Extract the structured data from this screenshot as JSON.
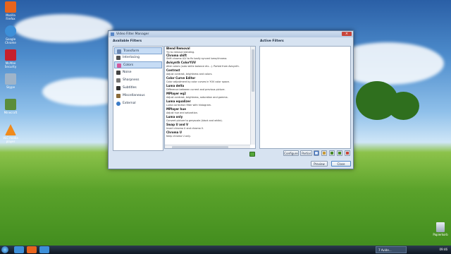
{
  "desktop": {
    "icons": [
      {
        "label": "Mozilla Firefox",
        "icon": "firefox-icon",
        "color": "#e8641d"
      },
      {
        "label": "Google Chrome",
        "icon": "chrome-icon",
        "color": "#3d8fd8"
      },
      {
        "label": "McAfee Security",
        "icon": "mcafee-icon",
        "color": "#c5202d"
      },
      {
        "label": "Skype",
        "icon": "skype-icon",
        "color": "#9fb4c9"
      },
      {
        "label": "Minecraft",
        "icon": "minecraft-icon",
        "color": "#5b8d3a"
      },
      {
        "label": "VLC media player",
        "icon": "vlc-icon",
        "color": "#f08a1c"
      }
    ],
    "recycle_bin_label": "Papierkorb"
  },
  "window": {
    "title": "Video Filter Manager",
    "available_heading": "Available Filters",
    "active_heading": "Active Filters",
    "categories": [
      {
        "label": "Transform",
        "icon": "transform-icon",
        "color": "#6b86b0"
      },
      {
        "label": "Interlacing",
        "icon": "interlacing-icon",
        "color": "#555555"
      },
      {
        "label": "Colors",
        "icon": "colors-icon",
        "color": "#d35a9c"
      },
      {
        "label": "Noise",
        "icon": "noise-icon",
        "color": "#444444"
      },
      {
        "label": "Sharpness",
        "icon": "sharpness-icon",
        "color": "#777777"
      },
      {
        "label": "Subtitles",
        "icon": "subtitles-icon",
        "color": "#333333"
      },
      {
        "label": "Miscellaneous",
        "icon": "misc-icon",
        "color": "#8a6b3a"
      },
      {
        "label": "External",
        "icon": "external-icon",
        "color": "#3b7bc6"
      }
    ],
    "filters": [
      {
        "name": "Blend Removal",
        "desc": "Try to remove blending."
      },
      {
        "name": "Chroma shift",
        "desc": "Shift chroma U/V to fix badly synced luma/chroma."
      },
      {
        "name": "Avisynth ColorYUV",
        "desc": "Alter colors (auto white balance etc...). Ported from Avisynth."
      },
      {
        "name": "Contrast",
        "desc": "Adjust contrast, brightness and colors."
      },
      {
        "name": "Color Curve Editor",
        "desc": "Color adjustment by color curves in YUV color space."
      },
      {
        "name": "Luma delta",
        "desc": "Difference between current and previous picture."
      },
      {
        "name": "MPlayer eq2",
        "desc": "Adjust contrast, brightness, saturation and gamma."
      },
      {
        "name": "Luma equalizer",
        "desc": "Luma correction filter with histogram."
      },
      {
        "name": "MPlayer hue",
        "desc": "Adjust hue and saturation."
      },
      {
        "name": "Luma only",
        "desc": "Convert picture to greyscale (black and white)."
      },
      {
        "name": "Swap U and V",
        "desc": "Invert chroma U and chroma V."
      },
      {
        "name": "Chroma U",
        "desc": "Keep chroma U only."
      }
    ],
    "buttons": {
      "configure": "Configure",
      "partial": "Partial",
      "preview": "Preview",
      "close": "Close"
    }
  },
  "taskbar": {
    "task_label": "7 Avide...",
    "clock": "09:46"
  }
}
